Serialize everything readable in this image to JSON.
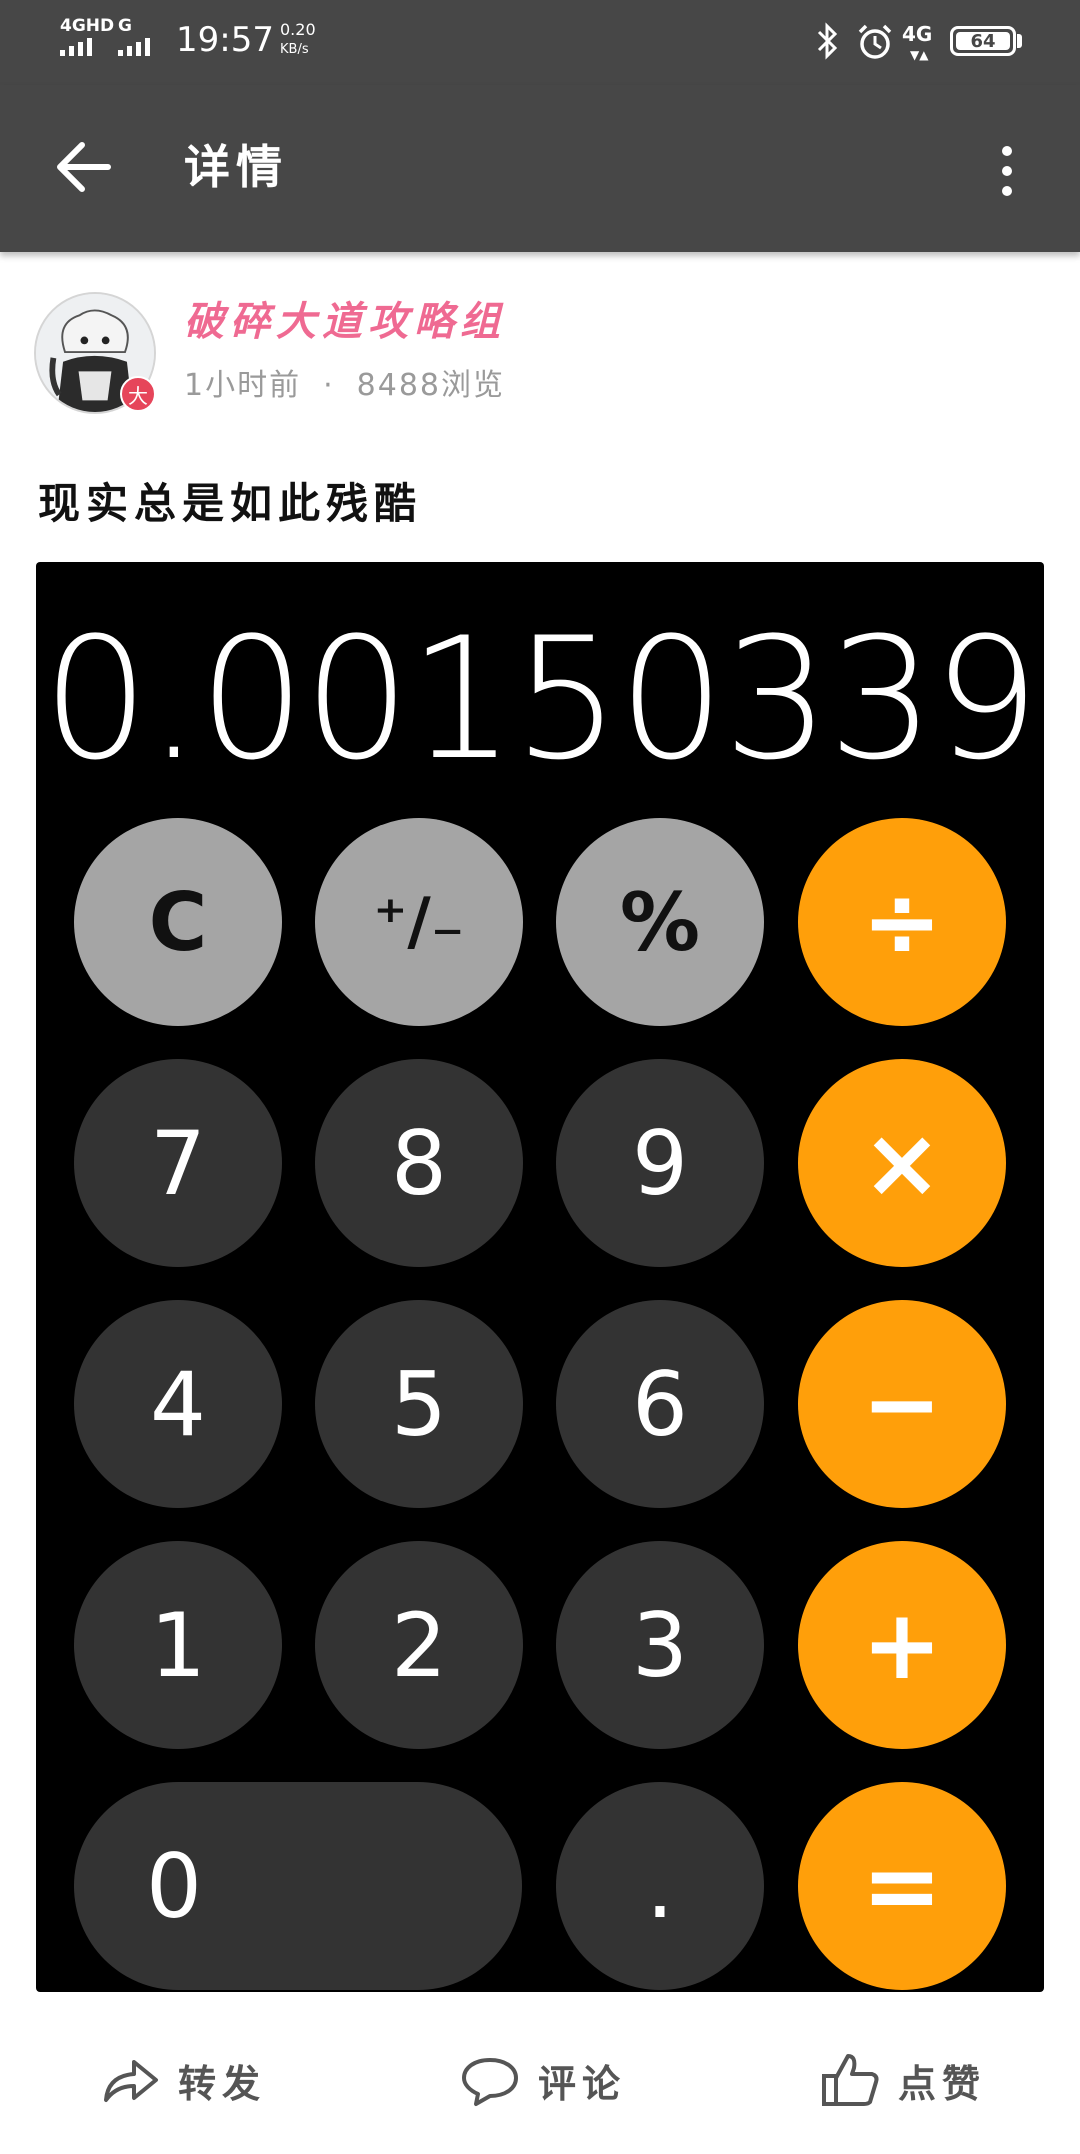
{
  "status_bar": {
    "network1": "4GHD",
    "network2": "G",
    "time": "19:57",
    "speed_value": "0.20",
    "speed_unit": "KB/s",
    "network3": "4G",
    "battery": "64"
  },
  "app_bar": {
    "title": "详情"
  },
  "author": {
    "name": "破碎大道攻略组",
    "badge": "大",
    "time_ago": "1小时前",
    "dot": "·",
    "views": "8488浏览"
  },
  "post": {
    "title": "现实总是如此残酷"
  },
  "calculator": {
    "display": "0.00150339",
    "keys": {
      "clear": "C",
      "sign": "⁺∕₋",
      "percent": "%",
      "divide": "÷",
      "k7": "7",
      "k8": "8",
      "k9": "9",
      "multiply": "×",
      "k4": "4",
      "k5": "5",
      "k6": "6",
      "minus": "−",
      "k1": "1",
      "k2": "2",
      "k3": "3",
      "plus": "+",
      "k0": "0",
      "dot": ".",
      "equals": "="
    },
    "colors": {
      "function_key": "#a5a5a5",
      "number_key": "#333333",
      "operator_key": "#ff9f0a"
    }
  },
  "actions": {
    "share": "转发",
    "comment": "评论",
    "like": "点赞"
  }
}
